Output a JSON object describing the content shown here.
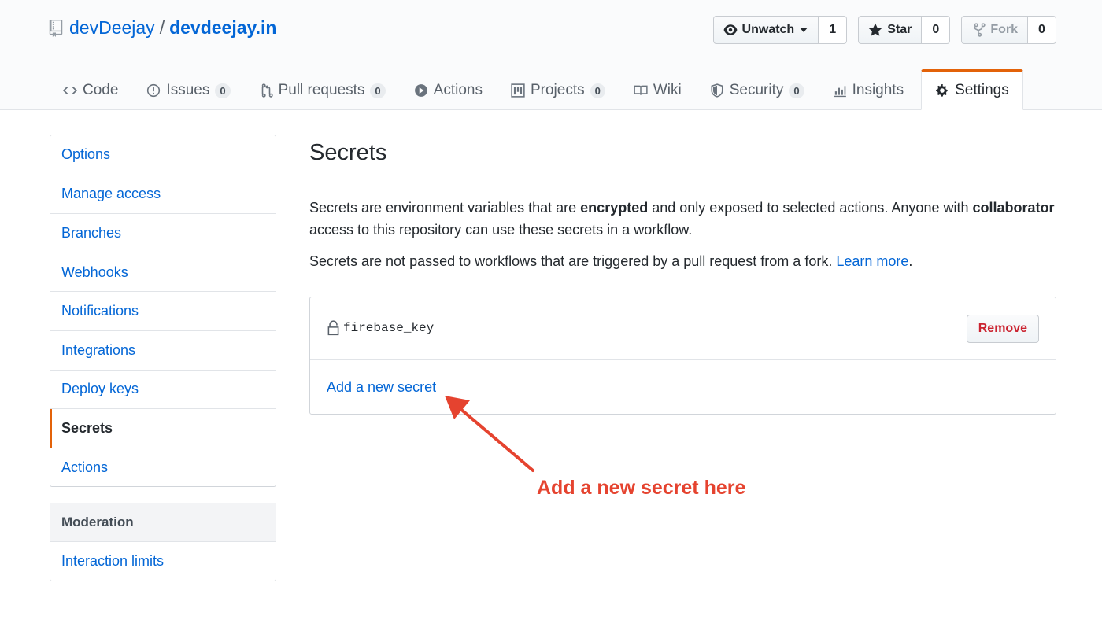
{
  "repo": {
    "owner": "devDeejay",
    "separator": "/",
    "name": "devdeejay.in"
  },
  "actions": {
    "watch": {
      "label": "Unwatch",
      "count": "1"
    },
    "star": {
      "label": "Star",
      "count": "0"
    },
    "fork": {
      "label": "Fork",
      "count": "0"
    }
  },
  "tabs": [
    {
      "label": "Code",
      "icon": "code-icon"
    },
    {
      "label": "Issues",
      "counter": "0",
      "icon": "issue-icon"
    },
    {
      "label": "Pull requests",
      "counter": "0",
      "icon": "pull-request-icon"
    },
    {
      "label": "Actions",
      "icon": "play-icon"
    },
    {
      "label": "Projects",
      "counter": "0",
      "icon": "project-icon"
    },
    {
      "label": "Wiki",
      "icon": "book-icon"
    },
    {
      "label": "Security",
      "counter": "0",
      "icon": "shield-icon"
    },
    {
      "label": "Insights",
      "icon": "graph-icon"
    },
    {
      "label": "Settings",
      "icon": "gear-icon",
      "selected": true
    }
  ],
  "sidebar": {
    "items": [
      {
        "label": "Options"
      },
      {
        "label": "Manage access"
      },
      {
        "label": "Branches"
      },
      {
        "label": "Webhooks"
      },
      {
        "label": "Notifications"
      },
      {
        "label": "Integrations"
      },
      {
        "label": "Deploy keys"
      },
      {
        "label": "Secrets",
        "selected": true
      },
      {
        "label": "Actions"
      }
    ],
    "moderation": {
      "heading": "Moderation",
      "items": [
        {
          "label": "Interaction limits"
        }
      ]
    }
  },
  "main": {
    "title": "Secrets",
    "p1_a": "Secrets are environment variables that are ",
    "p1_b": "encrypted",
    "p1_c": " and only exposed to selected actions. Anyone with ",
    "p1_d": "collaborator",
    "p1_e": " access to this repository can use these secrets in a workflow.",
    "p2_text": "Secrets are not passed to workflows that are triggered by a pull request from a fork. ",
    "p2_link": "Learn more",
    "p2_end": ".",
    "secrets": [
      {
        "name": "firebase_key",
        "remove_label": "Remove"
      }
    ],
    "add_link": "Add a new secret"
  },
  "annotation": {
    "text": "Add a new secret here",
    "color": "#e5432f"
  },
  "colors": {
    "link": "#0366d6",
    "accent": "#e36209",
    "danger": "#cb2431"
  }
}
